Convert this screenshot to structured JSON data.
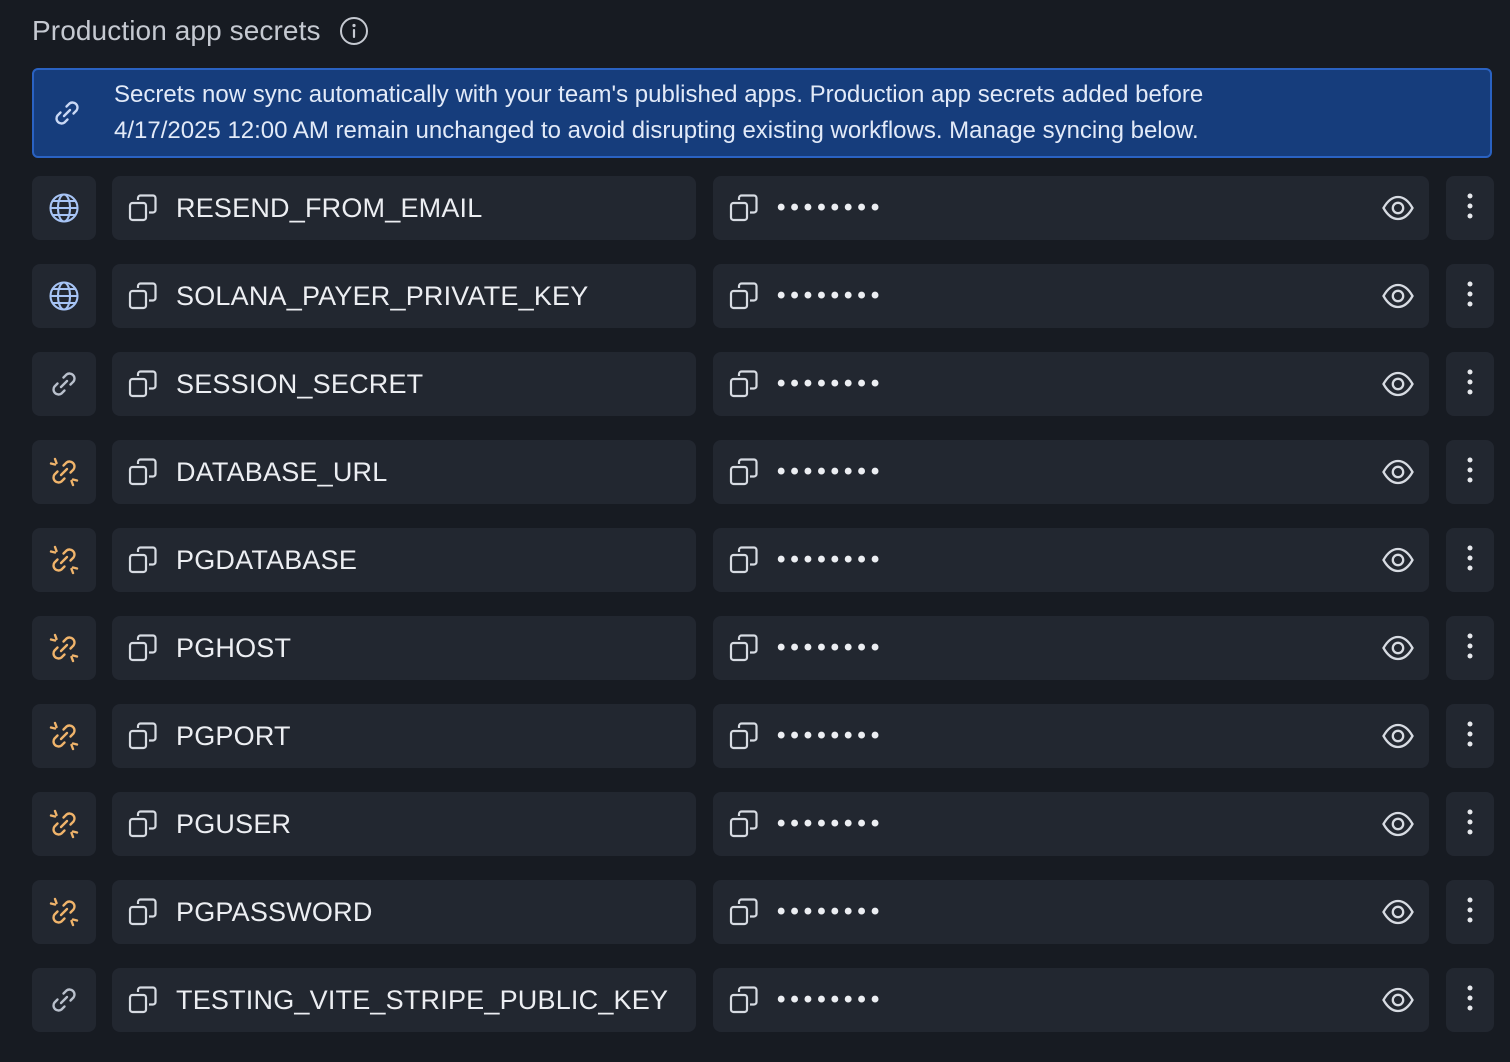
{
  "header": {
    "title": "Production app secrets",
    "info_icon": "info-circle-icon"
  },
  "banner": {
    "icon": "link-icon",
    "text": "Secrets now sync automatically with your team's published apps. Production app secrets added before 4/17/2025 12:00 AM remain unchanged to avoid disrupting existing workflows. Manage syncing below."
  },
  "colors": {
    "background": "#171b22",
    "row_background": "#222730",
    "banner_background": "#163d7c",
    "banner_border": "#2a62c2",
    "icon_default": "#b9c0cc",
    "globe_icon": "#a7c4f5",
    "unlinked_icon": "#f0b46b"
  },
  "secrets": [
    {
      "key": "RESEND_FROM_EMAIL",
      "masked_value": "••••••••",
      "sync_icon": "globe"
    },
    {
      "key": "SOLANA_PAYER_PRIVATE_KEY",
      "masked_value": "••••••••",
      "sync_icon": "globe"
    },
    {
      "key": "SESSION_SECRET",
      "masked_value": "••••••••",
      "sync_icon": "link"
    },
    {
      "key": "DATABASE_URL",
      "masked_value": "••••••••",
      "sync_icon": "unlink"
    },
    {
      "key": "PGDATABASE",
      "masked_value": "••••••••",
      "sync_icon": "unlink"
    },
    {
      "key": "PGHOST",
      "masked_value": "••••••••",
      "sync_icon": "unlink"
    },
    {
      "key": "PGPORT",
      "masked_value": "••••••••",
      "sync_icon": "unlink"
    },
    {
      "key": "PGUSER",
      "masked_value": "••••••••",
      "sync_icon": "unlink"
    },
    {
      "key": "PGPASSWORD",
      "masked_value": "••••••••",
      "sync_icon": "unlink"
    },
    {
      "key": "TESTING_VITE_STRIPE_PUBLIC_KEY",
      "masked_value": "••••••••",
      "sync_icon": "link"
    }
  ]
}
